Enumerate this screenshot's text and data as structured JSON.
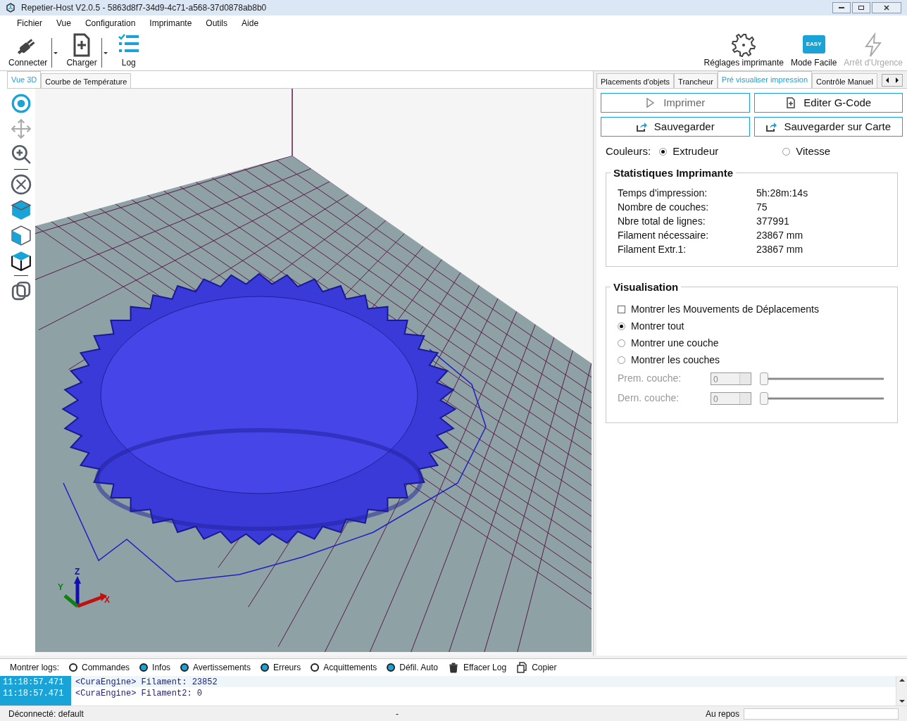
{
  "window": {
    "title": "Repetier-Host V2.0.5 - 5863d8f7-34d9-4c71-a568-37d0878ab8b0"
  },
  "menu": [
    "Fichier",
    "Vue",
    "Configuration",
    "Imprimante",
    "Outils",
    "Aide"
  ],
  "toolbar_left": [
    {
      "kind": "plug",
      "label": "Connecter",
      "dropdown": true
    },
    {
      "kind": "file",
      "label": "Charger",
      "dropdown": true
    },
    {
      "kind": "log",
      "label": "Log",
      "dropdown": false
    }
  ],
  "toolbar_right": [
    {
      "kind": "gear",
      "label": "Réglages imprimante",
      "disabled": false
    },
    {
      "kind": "easy",
      "label": "Mode Facile",
      "badge": "EASY",
      "disabled": false
    },
    {
      "kind": "bolt",
      "label": "Arrêt d'Urgence",
      "disabled": true
    }
  ],
  "view_tabs": [
    {
      "label": "Vue 3D",
      "selected": true
    },
    {
      "label": "Courbe de Température",
      "selected": false
    }
  ],
  "view_tools": [
    {
      "kind": "rotate"
    },
    {
      "kind": "move"
    },
    {
      "kind": "zoom"
    },
    {
      "kind": "sep"
    },
    {
      "kind": "fit"
    },
    {
      "kind": "iso"
    },
    {
      "kind": "front"
    },
    {
      "kind": "top"
    },
    {
      "kind": "sep"
    },
    {
      "kind": "objects"
    }
  ],
  "viewport": {
    "axis_labels": [
      "X",
      "Y",
      "Z"
    ]
  },
  "panel_tabs": [
    {
      "label": "Placements d'objets",
      "selected": false
    },
    {
      "label": "Trancheur",
      "selected": false
    },
    {
      "label": "Pré visualiser impression",
      "selected": true
    },
    {
      "label": "Contrôle Manuel",
      "selected": false
    }
  ],
  "actions": [
    {
      "kind": "play",
      "label": "Imprimer",
      "disabled": true
    },
    {
      "kind": "file",
      "label": "Editer G-Code",
      "disabled": false
    },
    {
      "kind": "share",
      "label": "Sauvegarder",
      "disabled": false
    },
    {
      "kind": "share",
      "label": "Sauvegarder sur Carte",
      "disabled": false
    }
  ],
  "colors": {
    "label": "Couleurs:",
    "options": [
      {
        "label": "Extrudeur",
        "selected": true
      },
      {
        "label": "Vitesse",
        "selected": false
      }
    ]
  },
  "stats": {
    "title": "Statistiques Imprimante",
    "rows": [
      {
        "label": "Temps d'impression:",
        "value": "5h:28m:14s"
      },
      {
        "label": "Nombre de couches:",
        "value": "75"
      },
      {
        "label": "Nbre total de lignes:",
        "value": "377991"
      },
      {
        "label": "Filament nécessaire:",
        "value": "23867 mm"
      },
      {
        "label": "Filament Extr.1:",
        "value": "23867 mm"
      }
    ]
  },
  "visualisation": {
    "title": "Visualisation",
    "options": [
      {
        "kind": "checkbox",
        "label": "Montrer les Mouvements de Déplacements",
        "checked": false
      },
      {
        "kind": "radio",
        "label": "Montrer tout",
        "checked": true
      },
      {
        "kind": "radio",
        "label": "Montrer une couche",
        "checked": false
      },
      {
        "kind": "radio",
        "label": "Montrer les couches",
        "checked": false
      }
    ],
    "layers": [
      {
        "label": "Prem. couche:",
        "value": "0",
        "level": 0,
        "disabled": true
      },
      {
        "label": "Dern. couche:",
        "value": "0",
        "level": 0,
        "disabled": true
      }
    ]
  },
  "log_filters": {
    "label": "Montrer logs:",
    "options": [
      {
        "kind": "toggle",
        "label": "Commandes",
        "on": false
      },
      {
        "kind": "toggle",
        "label": "Infos",
        "on": true
      },
      {
        "kind": "toggle",
        "label": "Avertissements",
        "on": true
      },
      {
        "kind": "toggle",
        "label": "Erreurs",
        "on": true
      },
      {
        "kind": "toggle",
        "label": "Acquittements",
        "on": false
      },
      {
        "kind": "toggle",
        "label": "Défil. Auto",
        "on": true
      },
      {
        "kind": "trash",
        "label": "Effacer Log"
      },
      {
        "kind": "copy",
        "label": "Copier"
      }
    ]
  },
  "log_lines": [
    {
      "time": "11:18:57.471",
      "text": "<CuraEngine> Filament: 23852",
      "selected": true
    },
    {
      "time": "11:18:57.471",
      "text": "<CuraEngine> Filament2: 0",
      "selected": false
    }
  ],
  "status_bar": {
    "connection": "Déconnecté: default",
    "middle": "-",
    "state": "Au repos"
  }
}
